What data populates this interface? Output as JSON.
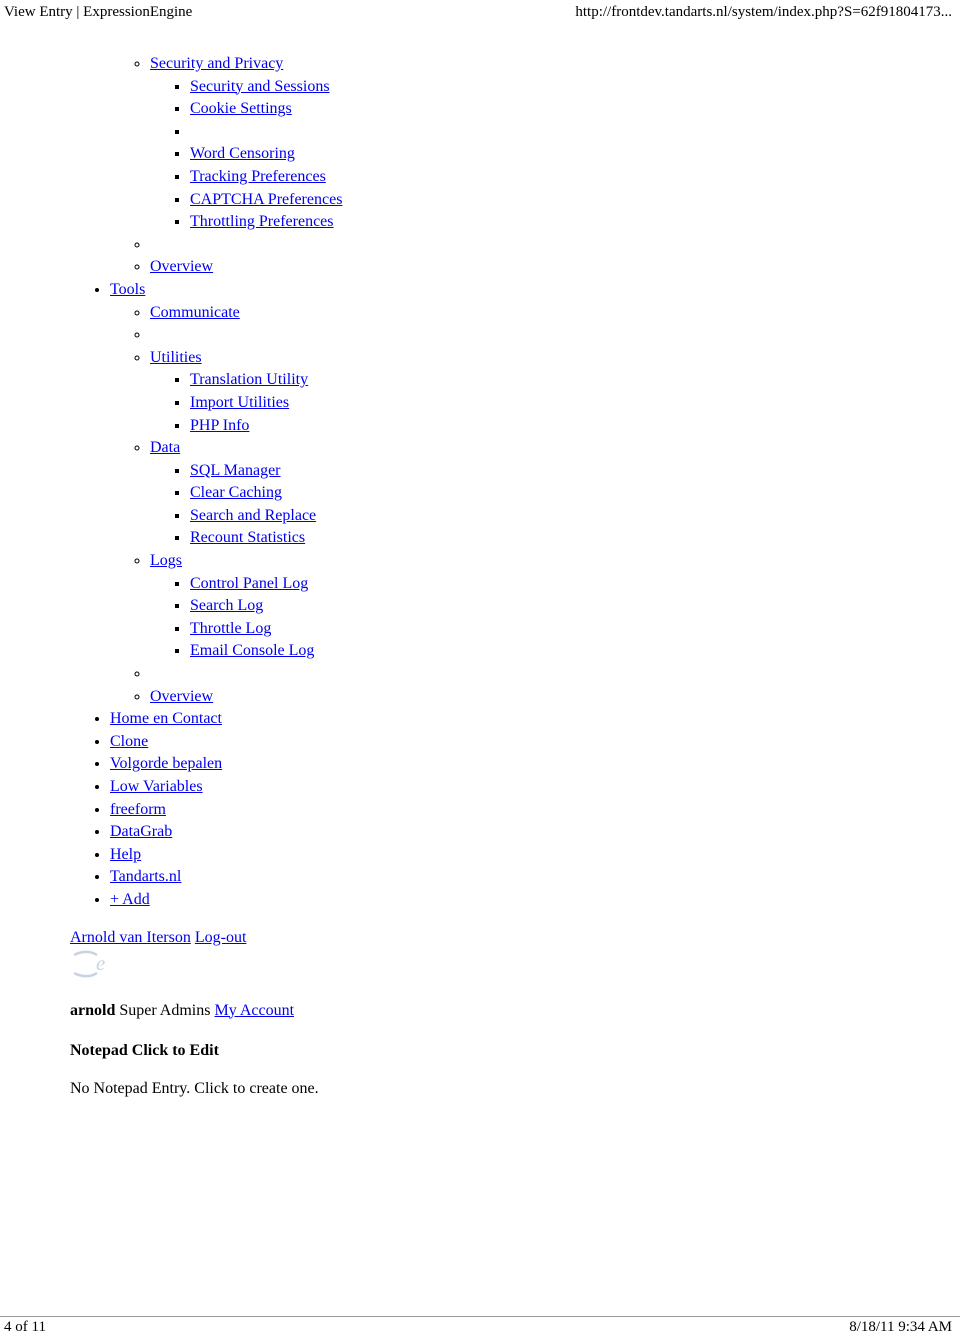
{
  "header": {
    "title": "View Entry | ExpressionEngine",
    "url": "http://frontdev.tandarts.nl/system/index.php?S=62f91804173..."
  },
  "nav": {
    "security_privacy": "Security and Privacy",
    "security_sessions": "Security and Sessions",
    "cookie_settings": "Cookie Settings",
    "word_censoring": "Word Censoring",
    "tracking_preferences": "Tracking Preferences",
    "captcha_preferences": "CAPTCHA Preferences",
    "throttling_preferences": "Throttling Preferences",
    "overview1": "Overview",
    "tools": "Tools",
    "communicate": "Communicate",
    "utilities": "Utilities",
    "translation_utility": "Translation Utility",
    "import_utilities": "Import Utilities",
    "php_info": "PHP Info",
    "data": "Data",
    "sql_manager": "SQL Manager",
    "clear_caching": "Clear Caching",
    "search_and_replace": "Search and Replace",
    "recount_statistics": "Recount Statistics",
    "logs": "Logs",
    "control_panel_log": "Control Panel Log",
    "search_log": "Search Log",
    "throttle_log": "Throttle Log",
    "email_console_log": "Email Console Log",
    "overview2": "Overview",
    "home_en_contact": "Home en Contact",
    "clone": "Clone",
    "volgorde_bepalen": "Volgorde bepalen",
    "low_variables": "Low Variables",
    "freeform": "freeform",
    "datagrab": "DataGrab",
    "help": "Help",
    "tandarts_nl": "Tandarts.nl",
    "add": "+ Add"
  },
  "user": {
    "name_link": "Arnold van Iterson",
    "logout": "Log-out",
    "username": "arnold",
    "role": "Super Admins",
    "my_account": "My Account"
  },
  "notepad": {
    "title": "Notepad Click to Edit",
    "body": "No Notepad Entry. Click to create one."
  },
  "footer": {
    "page": "4 of 11",
    "datetime": "8/18/11 9:34 AM"
  }
}
